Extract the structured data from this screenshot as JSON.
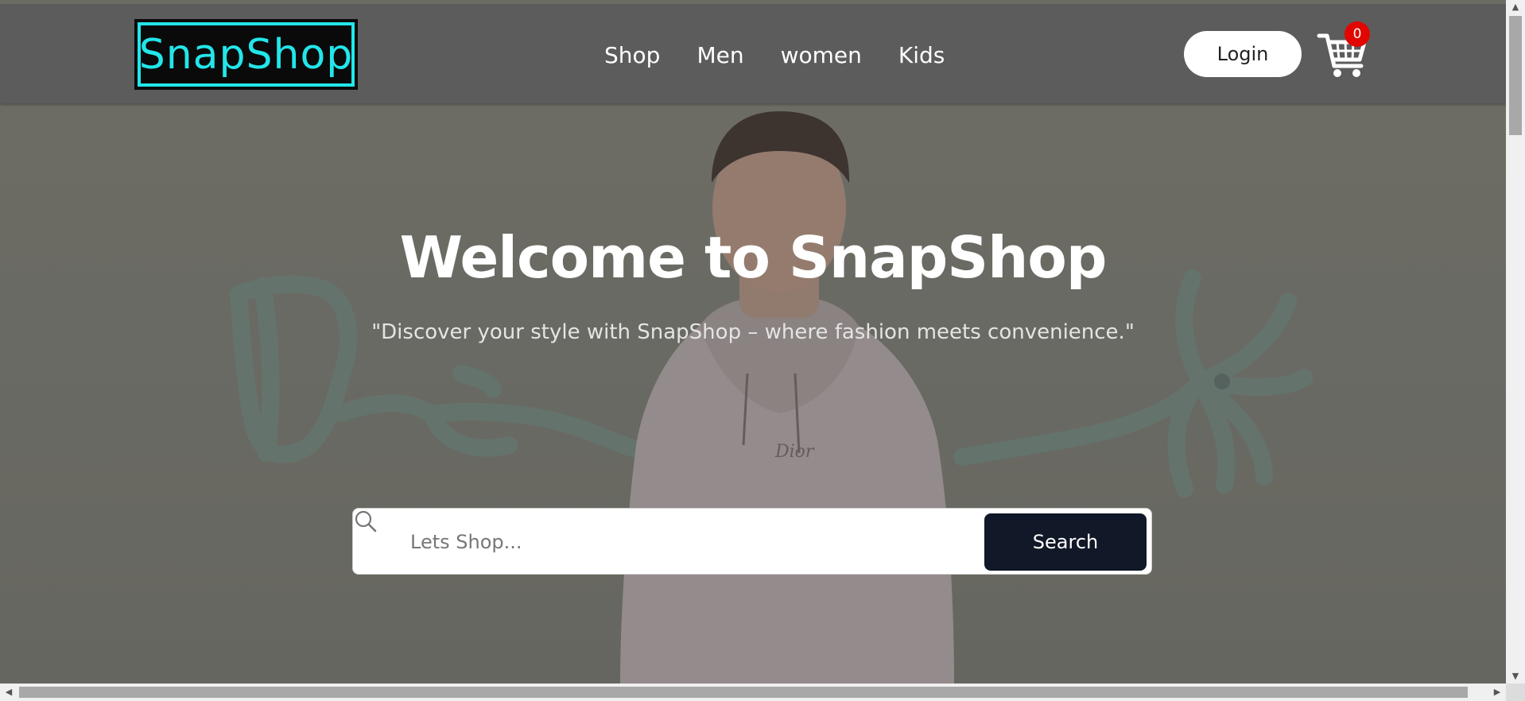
{
  "header": {
    "logo_text": "SnapShop",
    "nav": [
      "Shop",
      "Men",
      "women",
      "Kids"
    ],
    "login_label": "Login",
    "cart_count": "0"
  },
  "hero": {
    "title": "Welcome to SnapShop",
    "subtitle": "\"Discover your style with SnapShop – where fashion meets convenience.\""
  },
  "search": {
    "placeholder": "Lets Shop...",
    "button_label": "Search"
  },
  "colors": {
    "header_bg": "#5c5c5c",
    "logo_accent": "#22e6ea",
    "search_button": "#111827",
    "cart_badge": "#e10600"
  },
  "icons": [
    "search-icon",
    "cart-icon",
    "scroll-up-arrow-icon",
    "scroll-down-arrow-icon",
    "scroll-left-arrow-icon",
    "scroll-right-arrow-icon"
  ]
}
